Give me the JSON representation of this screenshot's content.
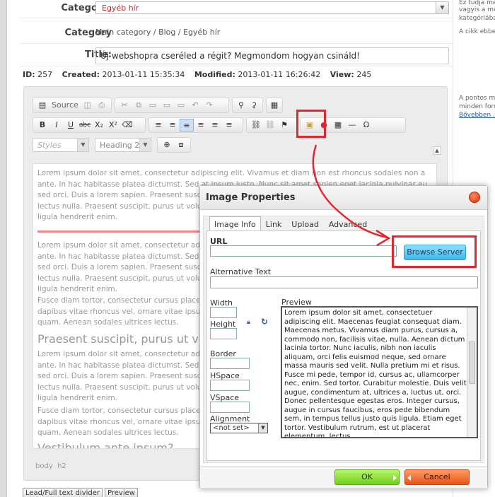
{
  "form": {
    "category_label": "Category:",
    "category_value": "Egyéb hír",
    "breadcrumb_label": "Category",
    "breadcrumb_value": "Main category / Blog / Egyéb hír",
    "title_label": "Title:",
    "title_value": "Új webshopra cseréled a régit? Megmondom hogyan csináld!"
  },
  "meta": {
    "id_label": "ID:",
    "id_value": "257",
    "created_label": "Created:",
    "created_value": "2013-01-11 15:35:34",
    "modified_label": "Modified:",
    "modified_value": "2013-01-11 16:26:42",
    "view_label": "View:",
    "view_value": "245"
  },
  "sidebar_right": {
    "line1": "Ez tudja meg",
    "line2": "vagyis a me",
    "line3": "kategóriába",
    "line4": "A cikk ebbe",
    "line5": "A pontos me",
    "line6": "minden forr",
    "link": "Bővebben ..."
  },
  "editor": {
    "source_label": "Source",
    "styles_label": "Styles",
    "format_label": "Heading 2",
    "path_body": "body",
    "path_h2": "h2",
    "para1": "Lorem ipsum dolor sit amet, consectetur adipiscing elit. Vivamus et diam non est rhoncus sodales non a ante. In hac habitasse platea dictumst. Sed at ipsum justo. Nunc sit amet sapien eget lacinia pulvinar eu sed orci. Duis a lorem sapien. Praesent suscipit, purus ut volutpat gravida, quam nisl vel. Donec eget lectus nulla. Praesent suscipit, purus ut volutpat gravida, quam nisl consequat lorem, quis viverra leo ligula hendrerit enim.",
    "para2": "Lorem ipsum dolor sit amet, consectetur adipiscing elit. Vivamus et diam non est rhoncus sodales non a ante. In hac habitasse platea dictumst. Sed at ipsum justo. Nunc sit amet sapien eget lacinia pulvinar eu sed orci. Duis a lorem sapien. Praesent suscipit, purus ut volutpat gravida, quam nisl vel. Donec eget lectus nulla. Praesent suscipit, purus ut volutpat gravida, quam nisl consequat lorem, quis viverra leo ligula hendrerit enim.",
    "para3": "Fusce diam tortor, consectetur cursus placerat at, condimentum at massa. Donec non urna ac lectus dapibus vitae rhoncus vel, ornare vitae ipsum. Maecenas tempor. Nullam tellus ac tellus eleifend gravida quam. Aenean sodales ultrices lectus.",
    "heading": "Praesent suscipit, purus ut volutpat gravida",
    "para4": "Lorem ipsum dolor sit amet, consectetur adipiscing elit. Vivamus et diam non est rhoncus sodales non a ante. In hac habitasse platea dictumst. Sed at ipsum justo. Nunc sit amet sapien eget lacinia pulvinar eu sed orci. Duis a lorem sapien. Praesent suscipit, purus ut volutpat gravida, quam nisl vel. Donec eget lectus nulla. Praesent suscipit, purus ut volutpat gravida, quam nisl consequat lorem, quis viverra leo ligula hendrerit enim.",
    "para5": "Fusce diam tortor, consectetur cursus placerat at, condimentum at massa. Donec non urna ac lectus dapibus vitae rhoncus vel, ornare vitae ipsum. Maecenas tempor. Nullam tellus ac tellus eleifend gravida quam. Aenean sodales ultrices lectus.",
    "heading2": "Vestibulum ante ipsum?"
  },
  "bottom_buttons": {
    "divider": "Lead/Full text divider",
    "preview": "Preview"
  },
  "dialog": {
    "title": "Image Properties",
    "tabs": [
      "Image Info",
      "Link",
      "Upload",
      "Advanced"
    ],
    "url_label": "URL",
    "browse_label": "Browse Server",
    "alt_label": "Alternative Text",
    "width_label": "Width",
    "height_label": "Height",
    "border_label": "Border",
    "hspace_label": "HSpace",
    "vspace_label": "VSpace",
    "alignment_label": "Alignment",
    "alignment_value": "<not set>",
    "preview_label": "Preview",
    "preview_text": "Lorem ipsum dolor sit amet, consectetuer adipiscing elit. Maecenas feugiat consequat diam. Maecenas metus. Vivamus diam purus, cursus a, commodo non, facilisis vitae, nulla. Aenean dictum lacinia tortor. Nunc iaculis, nibh non iaculis aliquam, orci felis euismod neque, sed ornare massa mauris sed velit. Nulla pretium mi et risus. Fusce mi pede, tempor id, cursus ac, ullamcorper nec, enim. Sed tortor. Curabitur molestie. Duis velit augue, condimentum at, ultrices a, luctus ut, orci. Donec pellentesque egestas eros. Integer cursus, augue in cursus faucibus, eros pede bibendum sem, in tempus tellus justo quis ligula. Etiam eget tortor. Vestibulum rutrum, est ut placerat elementum, lectus",
    "ok_label": "OK",
    "cancel_label": "Cancel"
  },
  "colors": {
    "highlight": "#e4262f",
    "browse_button": "#3fb8ee",
    "ok_button": "#6fcf1d",
    "cancel_button": "#e85417"
  }
}
